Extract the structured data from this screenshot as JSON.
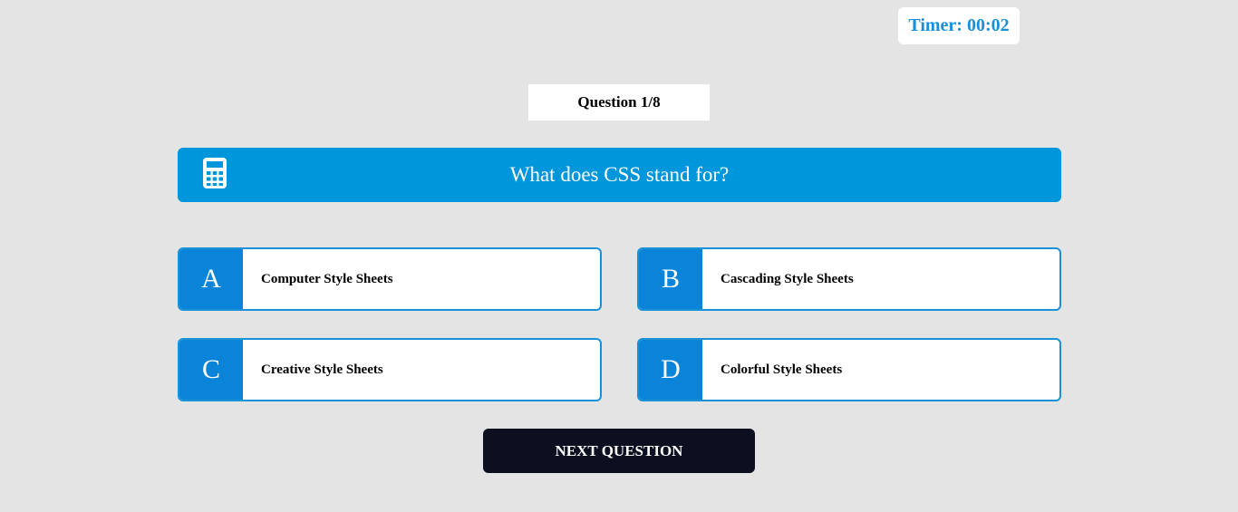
{
  "timer": {
    "label": "Timer: 00:02"
  },
  "question": {
    "counter": "Question 1/8",
    "text": "What does CSS stand for?",
    "icon": "calculator-icon"
  },
  "options": [
    {
      "letter": "A",
      "label": "Computer Style Sheets"
    },
    {
      "letter": "B",
      "label": "Cascading Style Sheets"
    },
    {
      "letter": "C",
      "label": "Creative Style Sheets"
    },
    {
      "letter": "D",
      "label": "Colorful Style Sheets"
    }
  ],
  "next_button": {
    "label": "NEXT QUESTION"
  },
  "colors": {
    "background": "#e4e4e4",
    "accent": "#0096db",
    "option_letter_bg": "#0a84d8",
    "timer_text": "#1a8fd6",
    "button_bg": "#0b0f20"
  }
}
